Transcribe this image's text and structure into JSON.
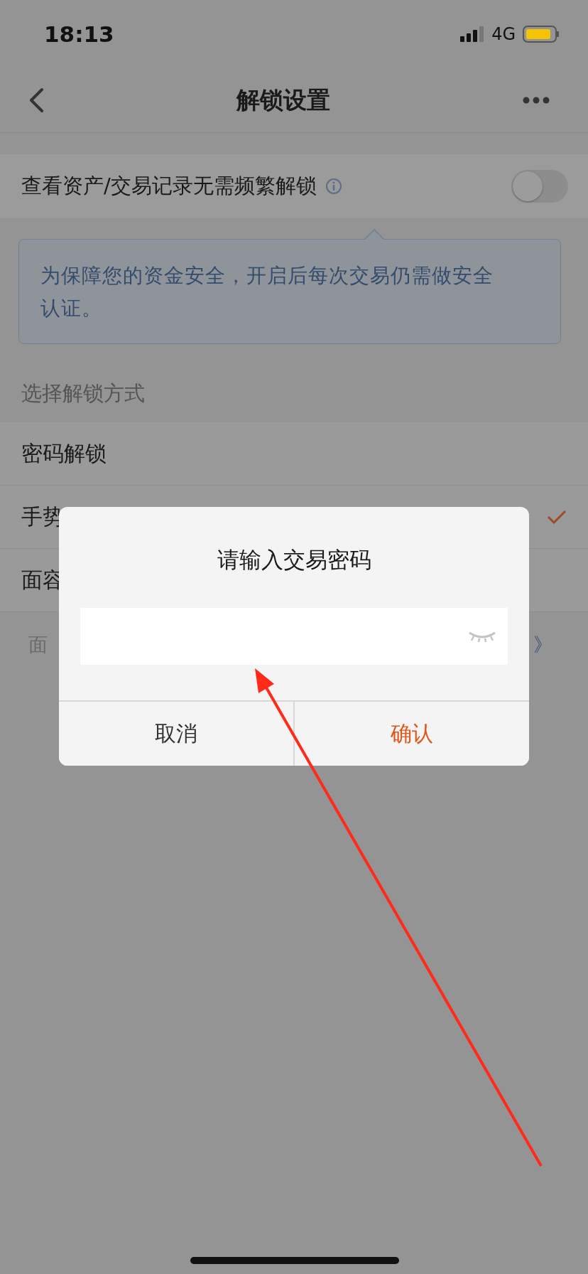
{
  "status_bar": {
    "time": "18:13",
    "network": "4G"
  },
  "nav": {
    "title": "解锁设置"
  },
  "toggle_row": {
    "label": "查看资产/交易记录无需频繁解锁",
    "on": false
  },
  "tip": {
    "text": "为保障您的资金安全，开启后每次交易仍需做安全认证。"
  },
  "section_header": "选择解锁方式",
  "unlock_methods": [
    {
      "label": "密码解锁",
      "selected": false
    },
    {
      "label": "手势",
      "selected": true
    },
    {
      "label": "面容",
      "selected": false
    }
  ],
  "footer": {
    "text": "面",
    "link": "》"
  },
  "dialog": {
    "title": "请输入交易密码",
    "password_visible": false,
    "buttons": [
      {
        "label": "取消",
        "kind": "cancel"
      },
      {
        "label": "确认",
        "kind": "confirm"
      }
    ]
  }
}
